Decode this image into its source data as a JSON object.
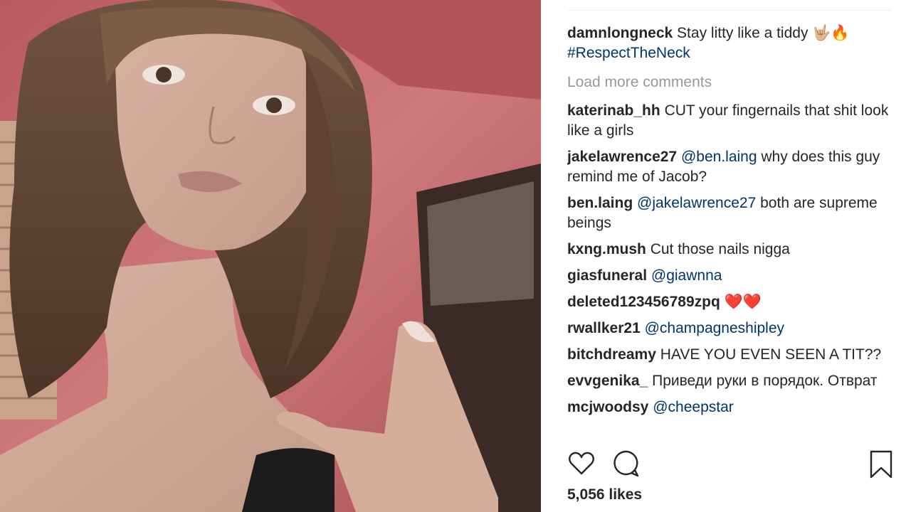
{
  "caption": {
    "username": "damnlongneck",
    "text": "Stay litty like a tiddy 🤟🏼🔥",
    "hashtag": "#RespectTheNeck"
  },
  "load_more_label": "Load more comments",
  "comments": [
    {
      "user": "katerinab_hh",
      "mention": "",
      "text": "CUT your fingernails that shit look like a girls"
    },
    {
      "user": "jakelawrence27",
      "mention": "@ben.laing",
      "text": "why does this guy remind me of Jacob?"
    },
    {
      "user": "ben.laing",
      "mention": "@jakelawrence27",
      "text": "both are supreme beings"
    },
    {
      "user": "kxng.mush",
      "mention": "",
      "text": "Cut those nails nigga"
    },
    {
      "user": "giasfuneral",
      "mention": "@giawnna",
      "text": ""
    },
    {
      "user": "deleted123456789zpq",
      "mention": "",
      "text": "❤️❤️"
    },
    {
      "user": "rwallker21",
      "mention": "@champagneshipley",
      "text": ""
    },
    {
      "user": "bitchdreamy",
      "mention": "",
      "text": "HAVE YOU EVEN SEEN A TIT??"
    },
    {
      "user": "evvgenika_",
      "mention": "",
      "text": "Приведи руки в порядок. Отврат"
    },
    {
      "user": "mcjwoodsy",
      "mention": "@cheepstar",
      "text": ""
    }
  ],
  "actions": {
    "like_icon": "heart-icon",
    "comment_icon": "comment-icon",
    "save_icon": "bookmark-icon"
  },
  "likes_label": "5,056 likes",
  "colors": {
    "username": "#262626",
    "mention": "#003569",
    "muted": "#999999",
    "wall": "#c46a6c"
  }
}
